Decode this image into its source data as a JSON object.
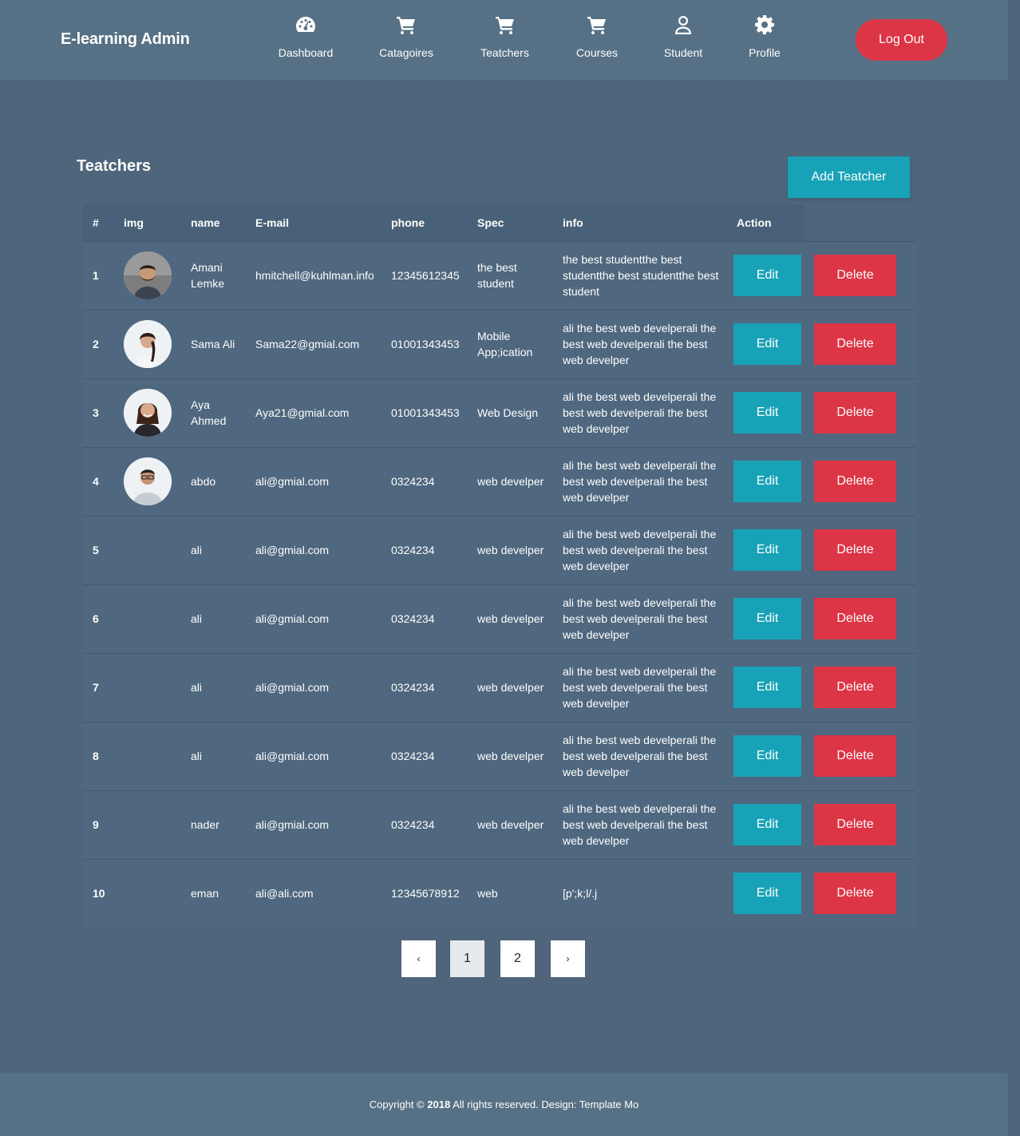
{
  "app": {
    "brand": "E-learning Admin",
    "logout_label": "Log Out"
  },
  "nav": [
    {
      "label": "Dashboard",
      "icon": "speedometer-icon"
    },
    {
      "label": "Catagoires",
      "icon": "cart-icon"
    },
    {
      "label": "Teatchers",
      "icon": "cart-icon"
    },
    {
      "label": "Courses",
      "icon": "cart-icon"
    },
    {
      "label": "Student",
      "icon": "user-icon"
    },
    {
      "label": "Profile",
      "icon": "gear-icon"
    }
  ],
  "page": {
    "title": "Teatchers",
    "add_button": "Add Teatcher"
  },
  "table": {
    "headers": [
      "#",
      "img",
      "name",
      "E-mail",
      "phone",
      "Spec",
      "info",
      "Action"
    ],
    "edit_label": "Edit",
    "delete_label": "Delete",
    "rows": [
      {
        "num": "1",
        "avatar": "man-beard",
        "name": "Amani Lemke",
        "email": "hmitchell@kuhlman.info",
        "phone": "12345612345",
        "spec": "the best student",
        "info": "the best studentthe best studentthe best studentthe best student"
      },
      {
        "num": "2",
        "avatar": "woman-braid",
        "name": "Sama Ali",
        "email": "Sama22@gmial.com",
        "phone": "01001343453",
        "spec": "Mobile App;ication",
        "info": "ali the best web develperali the best web develperali the best web develper"
      },
      {
        "num": "3",
        "avatar": "woman-dark",
        "name": "Aya Ahmed",
        "email": "Aya21@gmial.com",
        "phone": "01001343453",
        "spec": "Web Design",
        "info": "ali the best web develperali the best web develperali the best web develper"
      },
      {
        "num": "4",
        "avatar": "man-glasses",
        "name": "abdo",
        "email": "ali@gmial.com",
        "phone": "0324234",
        "spec": "web develper",
        "info": "ali the best web develperali the best web develperali the best web develper"
      },
      {
        "num": "5",
        "avatar": "",
        "name": "ali",
        "email": "ali@gmial.com",
        "phone": "0324234",
        "spec": "web develper",
        "info": "ali the best web develperali the best web develperali the best web develper"
      },
      {
        "num": "6",
        "avatar": "",
        "name": "ali",
        "email": "ali@gmial.com",
        "phone": "0324234",
        "spec": "web develper",
        "info": "ali the best web develperali the best web develperali the best web develper"
      },
      {
        "num": "7",
        "avatar": "",
        "name": "ali",
        "email": "ali@gmial.com",
        "phone": "0324234",
        "spec": "web develper",
        "info": "ali the best web develperali the best web develperali the best web develper"
      },
      {
        "num": "8",
        "avatar": "",
        "name": "ali",
        "email": "ali@gmial.com",
        "phone": "0324234",
        "spec": "web develper",
        "info": "ali the best web develperali the best web develperali the best web develper"
      },
      {
        "num": "9",
        "avatar": "",
        "name": "nader",
        "email": "ali@gmial.com",
        "phone": "0324234",
        "spec": "web develper",
        "info": "ali the best web develperali the best web develperali the best web develper"
      },
      {
        "num": "10",
        "avatar": "",
        "name": "eman",
        "email": "ali@ali.com",
        "phone": "12345678912",
        "spec": "web",
        "info": "[p';k;l/.j"
      }
    ]
  },
  "pagination": {
    "prev": "‹",
    "pages": [
      "1",
      "2"
    ],
    "active": "1",
    "next": "›"
  },
  "footer": {
    "prefix": "Copyright © ",
    "year": "2018",
    "suffix": " All rights reserved. Design: Template Mo"
  },
  "colors": {
    "background": "#4e657b",
    "navbar": "#567086",
    "edit": "#17a2b8",
    "delete": "#dc3545"
  }
}
